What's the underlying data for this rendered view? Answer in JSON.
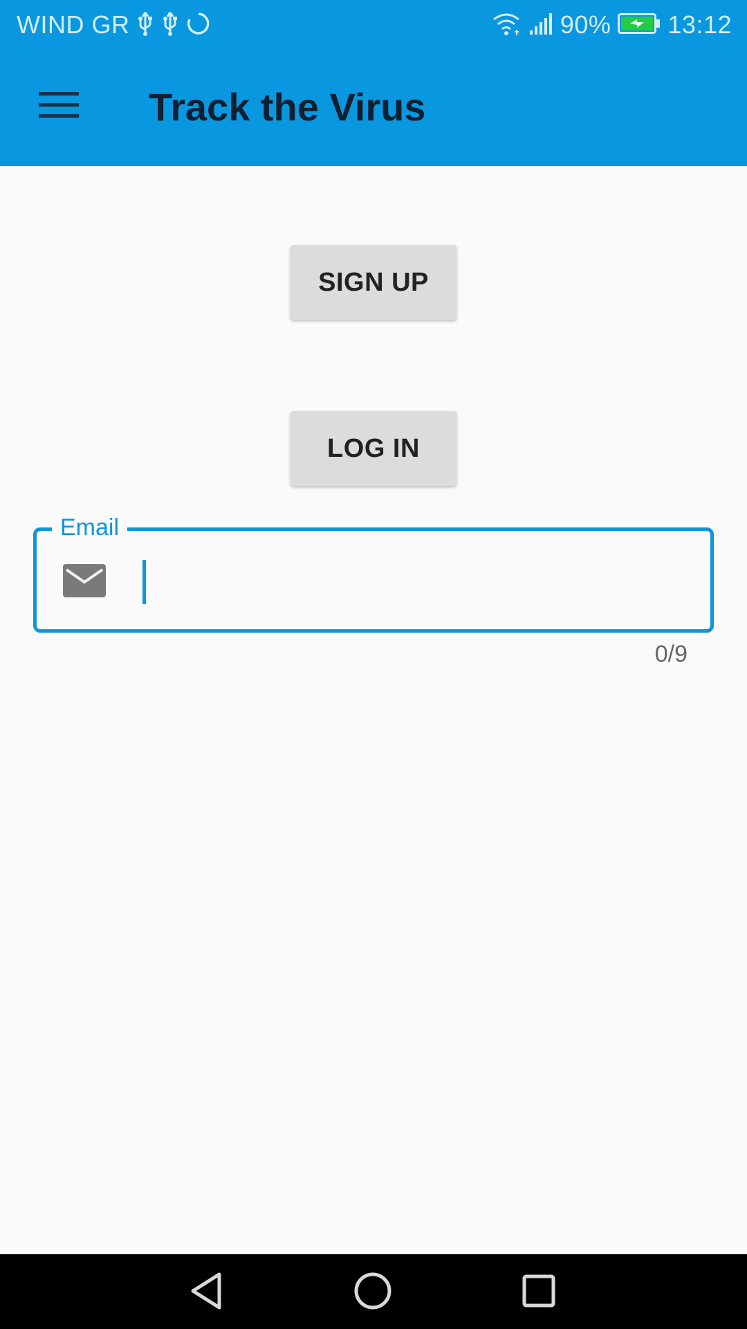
{
  "status_bar": {
    "carrier": "WIND GR",
    "battery_percent": "90%",
    "time": "13:12",
    "icons": [
      "usb-icon",
      "usb-icon",
      "sync-icon",
      "wifi-icon",
      "signal-icon",
      "battery-charging-icon"
    ]
  },
  "app_bar": {
    "title": "Track the Virus",
    "menu_icon": "hamburger-menu-icon"
  },
  "actions": {
    "signup_label": "SIGN UP",
    "login_label": "LOG IN"
  },
  "email_field": {
    "label": "Email",
    "value": "",
    "icon": "mail-icon",
    "counter": "0/9"
  },
  "nav_bar": {
    "back": "back-icon",
    "home": "home-icon",
    "recent": "recents-icon"
  },
  "colors": {
    "primary": "#0998e0",
    "accent": "#0f95dc",
    "button": "#dcdcdc",
    "background": "#fafafa"
  }
}
